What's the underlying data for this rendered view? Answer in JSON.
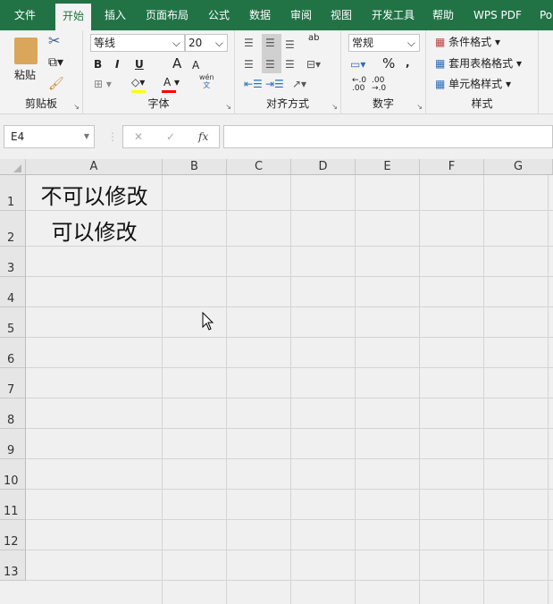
{
  "tabs": [
    "文件",
    "开始",
    "插入",
    "页面布局",
    "公式",
    "数据",
    "审阅",
    "视图",
    "开发工具",
    "帮助",
    "WPS PDF",
    "Po"
  ],
  "active_tab": "开始",
  "ribbon": {
    "clipboard": {
      "label": "剪贴板",
      "paste": "粘贴"
    },
    "font": {
      "label": "字体",
      "name": "等线",
      "size": "20",
      "bold": "B",
      "italic": "I",
      "underline": "U",
      "grow": "A",
      "shrink": "A",
      "color_a": "A",
      "phonetic_top": "wén",
      "phonetic_bottom": "文",
      "highlight_color": "#ffff00",
      "font_color": "#ff0000"
    },
    "alignment": {
      "label": "对齐方式",
      "wrap": "ab"
    },
    "number": {
      "label": "数字",
      "format": "常规",
      "percent": "%",
      "comma": ",",
      "inc_decimal": ".00",
      "dec_decimal": ".0"
    },
    "styles": {
      "label": "样式",
      "conditional": "条件格式",
      "table": "套用表格格式",
      "cell": "单元格样式"
    }
  },
  "formula_bar": {
    "name_box": "E4",
    "cancel": "✕",
    "enter": "✓",
    "fx": "fx",
    "value": ""
  },
  "columns": [
    "A",
    "B",
    "C",
    "D",
    "E",
    "F",
    "G"
  ],
  "rows": [
    "1",
    "2",
    "3",
    "4",
    "5",
    "6",
    "7",
    "8",
    "9",
    "10",
    "11",
    "12",
    "13"
  ],
  "cells": {
    "A1": "不可以修改",
    "A2": "可以修改"
  },
  "accent": "#217346"
}
